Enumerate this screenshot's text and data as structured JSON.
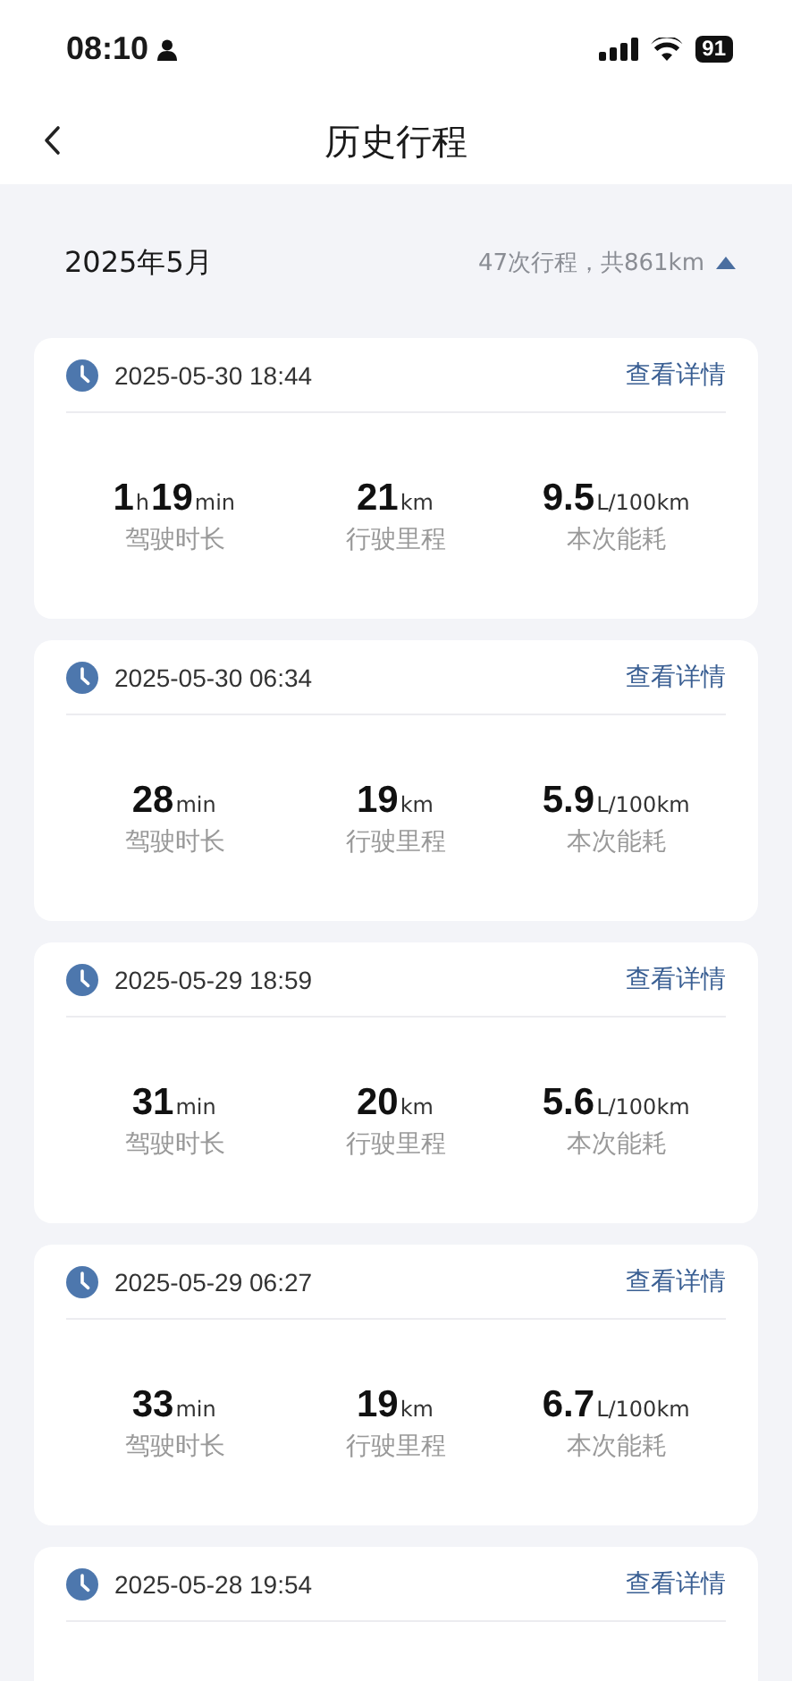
{
  "status_bar": {
    "time": "08:10",
    "battery": "91"
  },
  "header": {
    "title": "历史行程"
  },
  "month": {
    "label": "2025年5月",
    "summary": "47次行程，共861km"
  },
  "trips": [
    {
      "datetime": "2025-05-30 18:44",
      "link": "查看详情",
      "stats": [
        {
          "parts": [
            {
              "kind": "num",
              "text": "1"
            },
            {
              "kind": "unit",
              "text": "h"
            },
            {
              "kind": "num",
              "text": "19"
            },
            {
              "kind": "unit",
              "text": "min"
            }
          ],
          "label": "驾驶时长"
        },
        {
          "parts": [
            {
              "kind": "num",
              "text": "21"
            },
            {
              "kind": "unit",
              "text": "km"
            }
          ],
          "label": "行驶里程"
        },
        {
          "parts": [
            {
              "kind": "num",
              "text": "9.5"
            },
            {
              "kind": "unit",
              "text": "L/100km"
            }
          ],
          "label": "本次能耗"
        }
      ]
    },
    {
      "datetime": "2025-05-30 06:34",
      "link": "查看详情",
      "stats": [
        {
          "parts": [
            {
              "kind": "num",
              "text": "28"
            },
            {
              "kind": "unit",
              "text": "min"
            }
          ],
          "label": "驾驶时长"
        },
        {
          "parts": [
            {
              "kind": "num",
              "text": "19"
            },
            {
              "kind": "unit",
              "text": "km"
            }
          ],
          "label": "行驶里程"
        },
        {
          "parts": [
            {
              "kind": "num",
              "text": "5.9"
            },
            {
              "kind": "unit",
              "text": "L/100km"
            }
          ],
          "label": "本次能耗"
        }
      ]
    },
    {
      "datetime": "2025-05-29 18:59",
      "link": "查看详情",
      "stats": [
        {
          "parts": [
            {
              "kind": "num",
              "text": "31"
            },
            {
              "kind": "unit",
              "text": "min"
            }
          ],
          "label": "驾驶时长"
        },
        {
          "parts": [
            {
              "kind": "num",
              "text": "20"
            },
            {
              "kind": "unit",
              "text": "km"
            }
          ],
          "label": "行驶里程"
        },
        {
          "parts": [
            {
              "kind": "num",
              "text": "5.6"
            },
            {
              "kind": "unit",
              "text": "L/100km"
            }
          ],
          "label": "本次能耗"
        }
      ]
    },
    {
      "datetime": "2025-05-29 06:27",
      "link": "查看详情",
      "stats": [
        {
          "parts": [
            {
              "kind": "num",
              "text": "33"
            },
            {
              "kind": "unit",
              "text": "min"
            }
          ],
          "label": "驾驶时长"
        },
        {
          "parts": [
            {
              "kind": "num",
              "text": "19"
            },
            {
              "kind": "unit",
              "text": "km"
            }
          ],
          "label": "行驶里程"
        },
        {
          "parts": [
            {
              "kind": "num",
              "text": "6.7"
            },
            {
              "kind": "unit",
              "text": "L/100km"
            }
          ],
          "label": "本次能耗"
        }
      ]
    },
    {
      "datetime": "2025-05-28 19:54",
      "link": "查看详情"
    }
  ]
}
